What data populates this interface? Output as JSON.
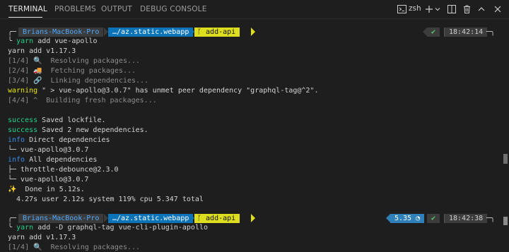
{
  "tabs": [
    {
      "label": "TERMINAL"
    },
    {
      "label": "PROBLEMS"
    },
    {
      "label": "OUTPUT"
    },
    {
      "label": "DEBUG CONSOLE"
    }
  ],
  "controls": {
    "shell": "zsh"
  },
  "prompt1": {
    "host": "Brians-MacBook-Pro",
    "dir": "…/az.static.webapp",
    "branch": "add-api",
    "status": "✔",
    "time": "18:42:14",
    "arrow": "╰",
    "cmd_yarn": "yarn",
    "cmd_args": "add vue-apollo"
  },
  "output1": [
    "yarn add v1.17.3",
    "[1/4] 🔍  Resolving packages...",
    "[2/4] 🚚  Fetching packages...",
    "[3/4] 🔗  Linking dependencies...",
    "warning",
    " \" > vue-apollo@3.0.7\" has unmet peer dependency \"graphql-tag@^2\".",
    "[4/4] ^  Building fresh packages...",
    "success",
    " Saved lockfile.",
    "success",
    " Saved 2 new dependencies.",
    "info",
    " Direct dependencies",
    "└─ vue-apollo@3.0.7",
    "info",
    " All dependencies",
    "├─ throttle-debounce@2.3.0",
    "└─ vue-apollo@3.0.7",
    "✨  Done in 5.12s.",
    "  4.27s user 2.12s system 119% cpu 5.347 total"
  ],
  "prompt2": {
    "host": "Brians-MacBook-Pro",
    "dir": "…/az.static.webapp",
    "branch": "add-api",
    "duration": "5.35",
    "duration_icon": "◔",
    "status": "✔",
    "time": "18:42:38",
    "arrow": "╰",
    "cmd_yarn": "yarn",
    "cmd_args": "add -D graphql-tag vue-cli-plugin-apollo"
  },
  "output2": [
    "yarn add v1.17.3",
    "[1/4] 🔍  Resolving packages..."
  ],
  "colors": {
    "background": "#1e1e1e",
    "success": "#23d18b",
    "info": "#3b8eea",
    "warning": "#e5e510",
    "dir_segment": "#0c73b8",
    "git_segment": "#dede20"
  }
}
